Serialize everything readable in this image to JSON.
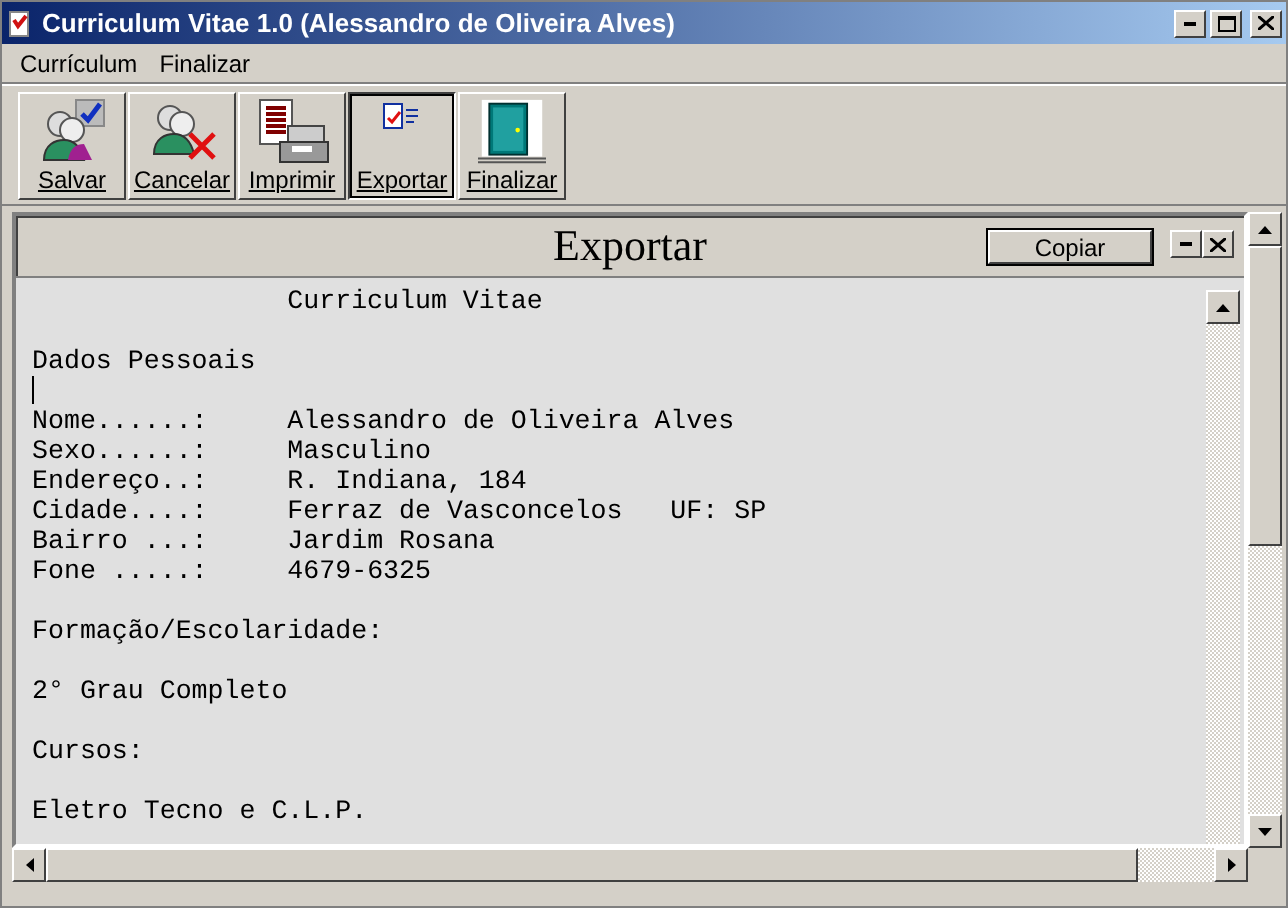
{
  "window": {
    "title": "Curriculum Vitae 1.0 (Alessandro de Oliveira Alves)"
  },
  "menu": [
    {
      "label": "Currículum"
    },
    {
      "label": "Finalizar"
    }
  ],
  "toolbar": [
    {
      "label": "Salvar",
      "kind": "save",
      "selected": false
    },
    {
      "label": "Cancelar",
      "kind": "cancel",
      "selected": false
    },
    {
      "label": "Imprimir",
      "kind": "print",
      "selected": false
    },
    {
      "label": "Exportar",
      "kind": "export",
      "selected": true
    },
    {
      "label": "Finalizar",
      "kind": "exit",
      "selected": false
    }
  ],
  "child_window": {
    "title": "Exportar",
    "copy_button": "Copiar",
    "lines": [
      {
        "kind": "heading",
        "text": "Curriculum Vitae"
      },
      {
        "kind": "gap"
      },
      {
        "kind": "text",
        "text": "Dados Pessoais"
      },
      {
        "kind": "caret"
      },
      {
        "kind": "text",
        "text": "Nome......:     Alessandro de Oliveira Alves"
      },
      {
        "kind": "text",
        "text": "Sexo......:     Masculino"
      },
      {
        "kind": "text",
        "text": "Endereço..:     R. Indiana, 184"
      },
      {
        "kind": "text",
        "text": "Cidade....:     Ferraz de Vasconcelos   UF: SP"
      },
      {
        "kind": "text",
        "text": "Bairro ...:     Jardim Rosana"
      },
      {
        "kind": "text",
        "text": "Fone .....:     4679-6325"
      },
      {
        "kind": "gap"
      },
      {
        "kind": "text",
        "text": "Formação/Escolaridade:"
      },
      {
        "kind": "gap"
      },
      {
        "kind": "text",
        "text": "2° Grau Completo"
      },
      {
        "kind": "gap"
      },
      {
        "kind": "text",
        "text": "Cursos:"
      },
      {
        "kind": "gap"
      },
      {
        "kind": "text",
        "text": "Eletro Tecno e C.L.P."
      }
    ]
  }
}
